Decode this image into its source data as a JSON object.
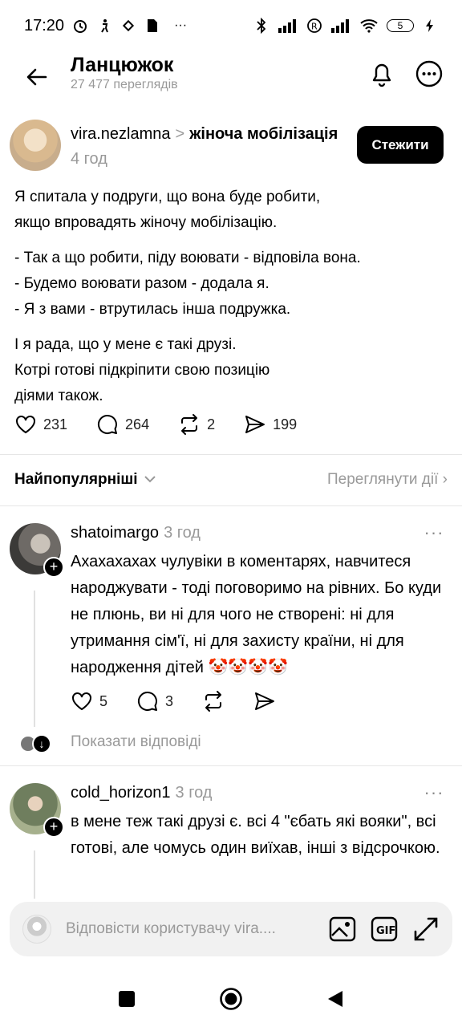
{
  "status": {
    "time": "17:20",
    "left_icons": [
      "alarm-icon",
      "figure-icon",
      "binance-icon",
      "sim-icon",
      "more-dots-icon"
    ],
    "right_icons": [
      "bluetooth-icon",
      "signal-icon",
      "roaming-icon",
      "signal-icon",
      "wifi-icon"
    ],
    "battery": "5"
  },
  "header": {
    "title": "Ланцюжок",
    "views": "27 477 переглядів"
  },
  "post": {
    "username": "vira.nezlamna",
    "chevron": ">",
    "topic": "жіноча мобілізація",
    "time": "4 год",
    "follow_label": "Стежити",
    "paragraphs": [
      "Я спитала у подруги, що вона буде робити,\nякщо впровадять жіночу мобілізацію.",
      "- Так а що робити, піду воювати - відповіла вона.\n- Будемо воювати разом - додала я.\n- Я з вами - втрутилась інша подружка.",
      "І я рада, що у мене є такі друзі.\nКотрі готові підкріпити свою позицію\nдіями також."
    ],
    "likes": "231",
    "comments": "264",
    "reposts": "2",
    "shares": "199"
  },
  "sort": {
    "label": "Найпопулярніші",
    "view_actions": "Переглянути дії"
  },
  "comments": [
    {
      "username": "shatoimargo",
      "time": "3 год",
      "text": "Ахахахахах чулувіки в коментарях, навчитеся народжувати - тоді поговоримо на рівних. Бо куди не плюнь, ви ні для чого не створені: ні для утримання сім'ї, ні для захисту країни, ні для народження дітей 🤡🤡🤡🤡",
      "likes": "5",
      "replies": "3",
      "show_replies": "Показати відповіді"
    },
    {
      "username": "cold_horizon1",
      "time": "3 год",
      "text": "в мене теж такі друзі є. всі 4 \"єбать які вояки\", всі готові, але чомусь один виїхав, інші з відсрочкою."
    }
  ],
  "reply_bar": {
    "placeholder": "Відповісти користувачу vira...."
  },
  "colors": {
    "muted": "#999999",
    "button": "#000000",
    "reply_bg": "#f1f1f1"
  }
}
